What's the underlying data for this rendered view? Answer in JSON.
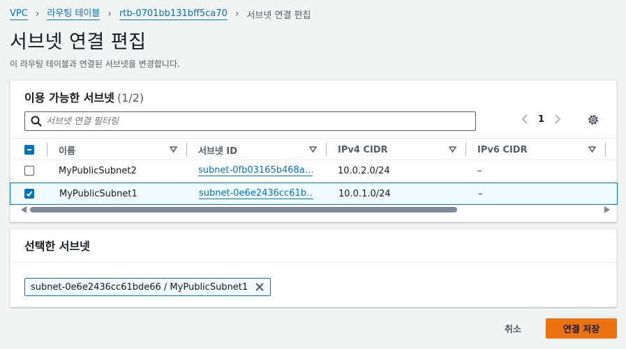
{
  "breadcrumb": {
    "items": [
      "VPC",
      "라우팅 테이블",
      "rtb-0701bb131bff5ca70"
    ],
    "current": "서브넷 연결 편집"
  },
  "page": {
    "title": "서브넷 연결 편집",
    "description": "이 라우팅 테이블과 연결된 서브넷을 변경합니다."
  },
  "available": {
    "title": "이용 가능한 서브넷",
    "count": "(1/2)",
    "search_placeholder": "서브넷 연결 필터링",
    "page": "1",
    "columns": [
      "이름",
      "서브넷 ID",
      "IPv4 CIDR",
      "IPv6 CIDR"
    ],
    "rows": [
      {
        "name": "MyPublicSubnet2",
        "subnet_id": "subnet-0fb03165b468a…",
        "ipv4": "10.0.2.0/24",
        "ipv6": "–",
        "checked": false
      },
      {
        "name": "MyPublicSubnet1",
        "subnet_id": "subnet-0e6e2436cc61b…",
        "ipv4": "10.0.1.0/24",
        "ipv6": "–",
        "checked": true
      }
    ]
  },
  "selected": {
    "title": "선택한 서브넷",
    "token": "subnet-0e6e2436cc61bde66 / MyPublicSubnet1"
  },
  "footer": {
    "cancel_label": "취소",
    "save_label": "연결 저장"
  },
  "colors": {
    "link": "#0073bb",
    "primary": "#ec7211"
  }
}
